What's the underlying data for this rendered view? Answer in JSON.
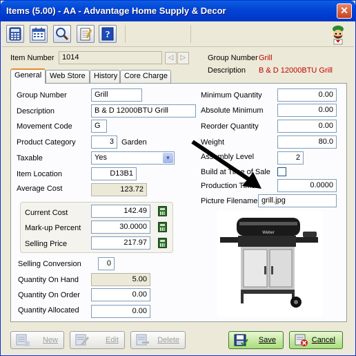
{
  "window": {
    "title": "Items (5.00) - AA - Advantage Home Supply & Decor",
    "close_glyph": "✕"
  },
  "toolbar": {
    "icons": [
      "calculator-icon",
      "calendar-icon",
      "magnifier-icon",
      "notepad-icon",
      "help-icon"
    ]
  },
  "header": {
    "item_number_label": "Item Number",
    "item_number": "1014",
    "group_number_label": "Group Number",
    "group_number": "Grill",
    "description_label": "Description",
    "description": "B & D 12000BTU Grill"
  },
  "tabs": [
    "General",
    "Web Store",
    "History",
    "Core Charge"
  ],
  "left": {
    "group_number": {
      "label": "Group Number",
      "value": "Grill"
    },
    "description": {
      "label": "Description",
      "value": "B & D 12000BTU Grill"
    },
    "movement_code": {
      "label": "Movement Code",
      "value": "G"
    },
    "product_category": {
      "label": "Product Category",
      "value": "3",
      "name": "Garden"
    },
    "taxable": {
      "label": "Taxable",
      "value": "Yes"
    },
    "item_location": {
      "label": "Item Location",
      "value": "D13B1"
    },
    "average_cost": {
      "label": "Average Cost",
      "value": "123.72"
    },
    "current_cost": {
      "label": "Current Cost",
      "value": "142.49"
    },
    "markup_percent": {
      "label": "Mark-up Percent",
      "value": "30.0000"
    },
    "selling_price": {
      "label": "Selling Price",
      "value": "217.97"
    },
    "selling_conversion": {
      "label": "Selling Conversion",
      "value": "0"
    },
    "qty_on_hand": {
      "label": "Quantity On Hand",
      "value": "5.00"
    },
    "qty_on_order": {
      "label": "Quantity On Order",
      "value": "0.00"
    },
    "qty_allocated": {
      "label": "Quantity Allocated",
      "value": "0.00"
    }
  },
  "right": {
    "minimum_quantity": {
      "label": "Minimum Quantity",
      "value": "0.00"
    },
    "absolute_minimum": {
      "label": "Absolute Minimum",
      "value": "0.00"
    },
    "reorder_quantity": {
      "label": "Reorder Quantity",
      "value": "0.00"
    },
    "weight": {
      "label": "Weight",
      "value": "80.0"
    },
    "assembly_level": {
      "label": "Assembly Level",
      "value": "2"
    },
    "build_at_time_of_sale": {
      "label": "Build at Time of Sale",
      "checked": false
    },
    "production_time": {
      "label": "Production Time",
      "value": "0.0000"
    },
    "picture_filename": {
      "label": "Picture Filename",
      "value": "grill.jpg"
    },
    "grill_brand": "Weber"
  },
  "buttons": {
    "new": "New",
    "edit": "Edit",
    "delete": "Delete",
    "save": "Save",
    "cancel": "Cancel"
  },
  "colors": {
    "title_blue": "#0445d6",
    "accent_red": "#c00000",
    "tab_orange": "#e68b2c",
    "save_green": "#a8dc7a"
  }
}
